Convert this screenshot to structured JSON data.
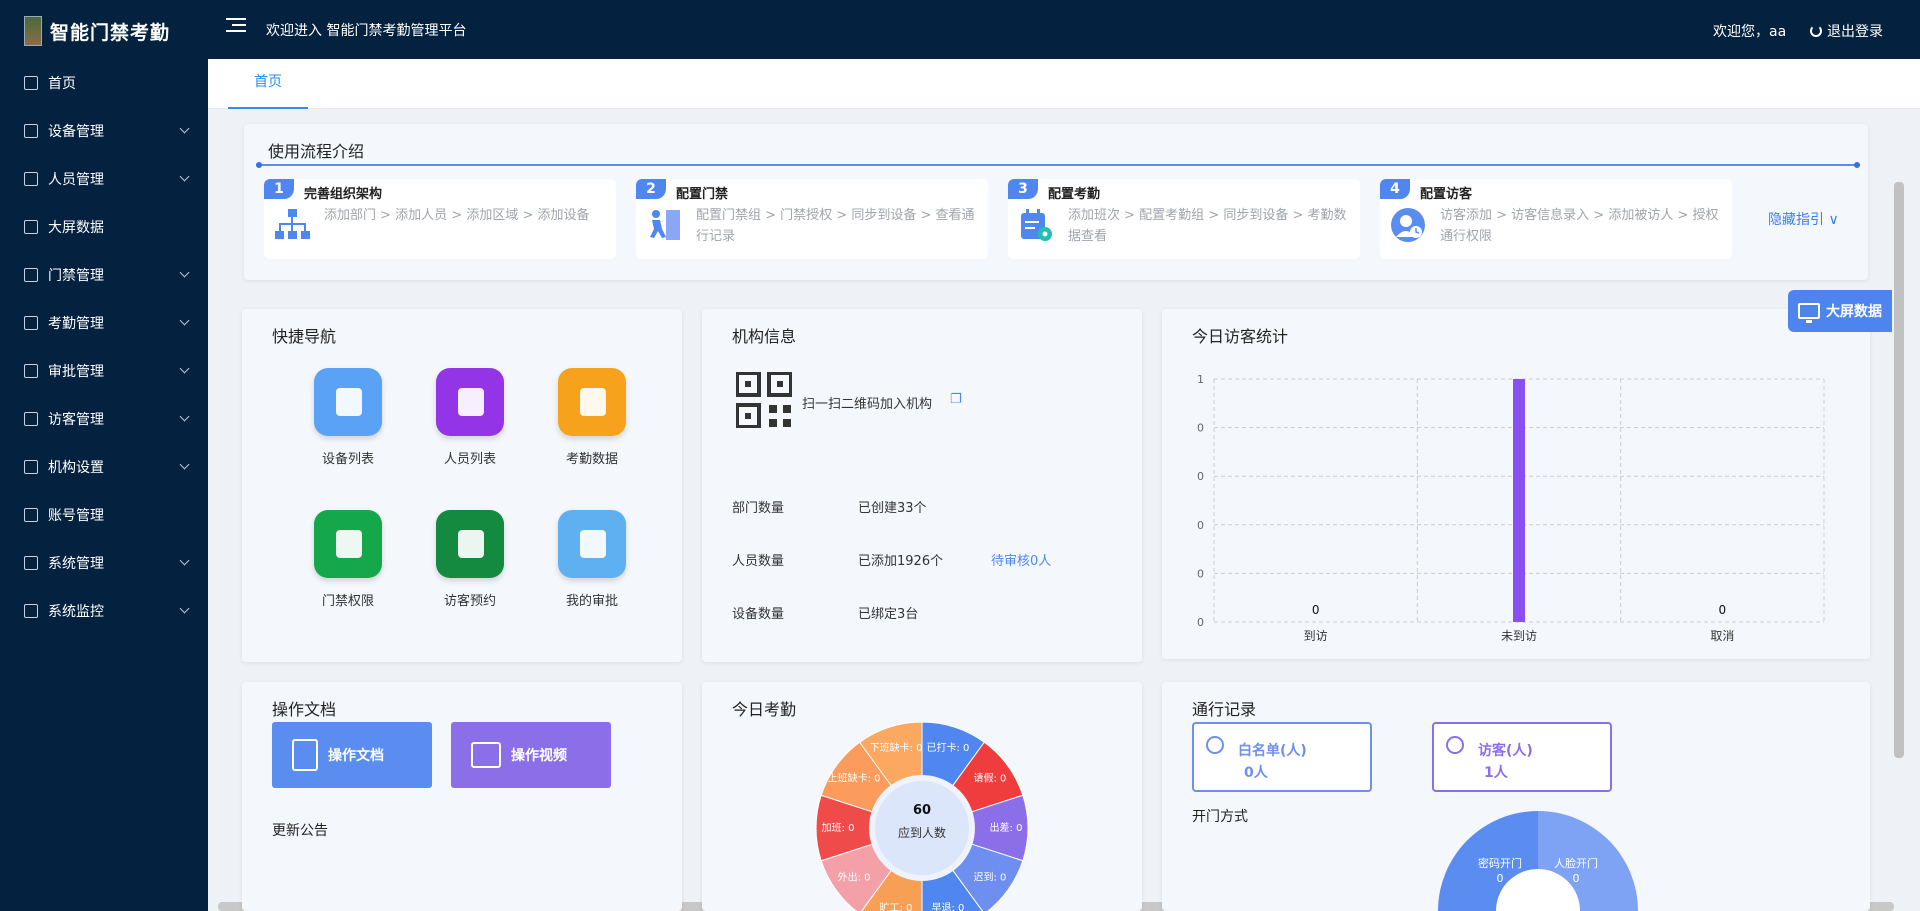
{
  "app": {
    "title": "智能门禁考勤",
    "welcome": "欢迎进入 智能门禁考勤管理平台"
  },
  "user": {
    "greeting": "欢迎您，aa",
    "logout": "退出登录"
  },
  "sidebar": {
    "items": [
      {
        "label": "首页",
        "icon": "home-icon",
        "expandable": false
      },
      {
        "label": "设备管理",
        "icon": "device-icon",
        "expandable": true
      },
      {
        "label": "人员管理",
        "icon": "person-card-icon",
        "expandable": true
      },
      {
        "label": "大屏数据",
        "icon": "bar-chart-icon",
        "expandable": false
      },
      {
        "label": "门禁管理",
        "icon": "door-icon",
        "expandable": true
      },
      {
        "label": "考勤管理",
        "icon": "attendance-icon",
        "expandable": true
      },
      {
        "label": "审批管理",
        "icon": "approval-icon",
        "expandable": true
      },
      {
        "label": "访客管理",
        "icon": "visitor-icon",
        "expandable": true
      },
      {
        "label": "机构设置",
        "icon": "org-icon",
        "expandable": true
      },
      {
        "label": "账号管理",
        "icon": "account-icon",
        "expandable": false
      },
      {
        "label": "系统管理",
        "icon": "gear-icon",
        "expandable": true
      },
      {
        "label": "系统监控",
        "icon": "monitor-gauge-icon",
        "expandable": true
      }
    ]
  },
  "tabs": [
    {
      "label": "首页",
      "active": true
    }
  ],
  "guide": {
    "title": "使用流程介绍",
    "hide_label": "隐藏指引",
    "steps": [
      {
        "num": "1",
        "title": "完善组织架构",
        "desc": "添加部门 > 添加人员 > 添加区域 > 添加设备"
      },
      {
        "num": "2",
        "title": "配置门禁",
        "desc": "配置门禁组 > 门禁授权 > 同步到设备 > 查看通行记录"
      },
      {
        "num": "3",
        "title": "配置考勤",
        "desc": "添加班次 > 配置考勤组 > 同步到设备 > 考勤数据查看"
      },
      {
        "num": "4",
        "title": "配置访客",
        "desc": "访客添加 > 访客信息录入 > 添加被访人 > 授权通行权限"
      }
    ]
  },
  "bigscreen_button": "大屏数据",
  "quick_nav": {
    "title": "快捷导航",
    "items": [
      {
        "label": "设备列表",
        "color": "#5aa2f6"
      },
      {
        "label": "人员列表",
        "color": "#9335e6"
      },
      {
        "label": "考勤数据",
        "color": "#f7a21c"
      },
      {
        "label": "门禁权限",
        "color": "#14a84a"
      },
      {
        "label": "访客预约",
        "color": "#138a3f"
      },
      {
        "label": "我的审批",
        "color": "#5fb0f1"
      }
    ]
  },
  "org_info": {
    "title": "机构信息",
    "qr_text": "扫一扫二维码加入机构",
    "rows": [
      {
        "label": "部门数量",
        "value": "已创建33个",
        "extra": ""
      },
      {
        "label": "人员数量",
        "value": "已添加1926个",
        "extra": "待审核0人"
      },
      {
        "label": "设备数量",
        "value": "已绑定3台",
        "extra": ""
      }
    ]
  },
  "visitor_stats": {
    "title": "今日访客统计",
    "top_label": "1"
  },
  "chart_data": {
    "type": "bar",
    "categories": [
      "到访",
      "未到访",
      "取消"
    ],
    "values": [
      0,
      1,
      0
    ],
    "ylim": [
      0,
      1
    ],
    "y_ticks": [
      "0",
      "0",
      "0",
      "0",
      "0",
      "1"
    ],
    "grid": true,
    "bar_color": "#8a4ff0"
  },
  "docs": {
    "title": "操作文档",
    "doc_btn": "操作文档",
    "video_btn": "操作视频",
    "notice_title": "更新公告"
  },
  "attendance": {
    "title": "今日考勤",
    "center_value": "60",
    "center_label": "应到人数",
    "segments": [
      {
        "label": "已打卡: 0",
        "color": "#4f86ef"
      },
      {
        "label": "请假: 0",
        "color": "#ef3d3d"
      },
      {
        "label": "出差: 0",
        "color": "#8b6fe8"
      },
      {
        "label": "迟到: 0",
        "color": "#6f8ff0"
      },
      {
        "label": "早退: 0",
        "color": "#4f86ef"
      },
      {
        "label": "旷工: 0",
        "color": "#f7a055"
      },
      {
        "label": "外出: 0",
        "color": "#f3a0a8"
      },
      {
        "label": "加班: 0",
        "color": "#f04b4b"
      },
      {
        "label": "上班缺卡: 0",
        "color": "#fb9b5c"
      },
      {
        "label": "下班缺卡: 0",
        "color": "#fca860"
      }
    ]
  },
  "pass_records": {
    "title": "通行记录",
    "whitelist_label": "白名单(人)",
    "whitelist_value": "0人",
    "visitor_label": "访客(人)",
    "visitor_value": "1人",
    "open_method_title": "开门方式",
    "methods": [
      {
        "label": "密码开门",
        "value": "0"
      },
      {
        "label": "人脸开门",
        "value": "0"
      }
    ]
  }
}
